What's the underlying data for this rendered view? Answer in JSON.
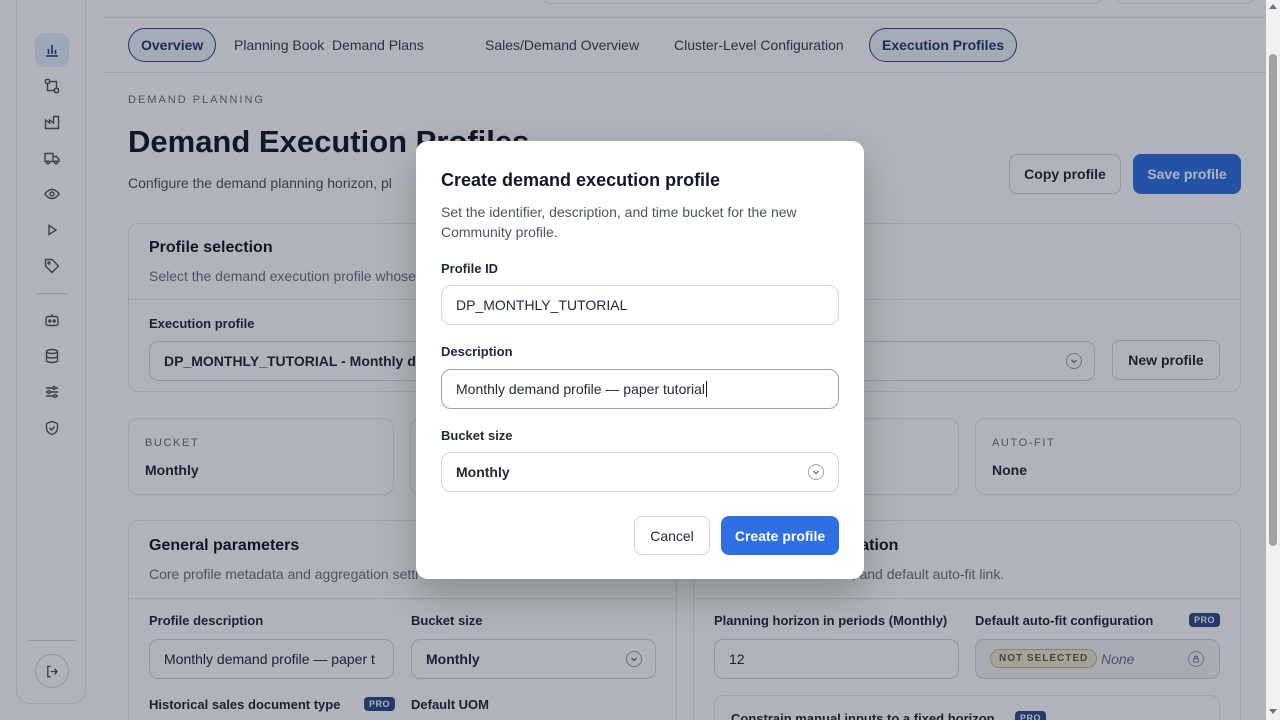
{
  "tabs": [
    {
      "label": "Overview"
    },
    {
      "label": "Planning Book"
    },
    {
      "label": "Demand Plans"
    },
    {
      "label": "Sales/Demand Overview"
    },
    {
      "label": "Cluster-Level Configuration"
    },
    {
      "label": "Execution Profiles"
    }
  ],
  "sidebar": {
    "icons": [
      "bar-chart-icon",
      "workflow-icon",
      "factory-icon",
      "truck-icon",
      "eye-icon",
      "play-icon",
      "tag-icon",
      "robot-icon",
      "database-icon",
      "sliders-icon",
      "shield-check-icon"
    ],
    "logout_icon": "logout-icon"
  },
  "header": {
    "eyebrow": "DEMAND PLANNING",
    "title": "Demand Execution Profiles",
    "subtitle": "Configure the demand planning horizon, pl",
    "copy_button": "Copy profile",
    "save_button": "Save profile"
  },
  "profile_selection": {
    "title": "Profile selection",
    "subtitle": "Select the demand execution profile whose",
    "field_label": "Execution profile",
    "selected_value": "DP_MONTHLY_TUTORIAL - Monthly der",
    "new_button": "New profile"
  },
  "stats": [
    {
      "key": "BUCKET",
      "value": "Monthly"
    },
    {
      "key": "AUTO-FIT",
      "value": "None"
    }
  ],
  "general": {
    "title": "General parameters",
    "subtitle": "Core profile metadata and aggregation setti",
    "profile_description_label": "Profile description",
    "profile_description_value": "Monthly demand profile — paper t",
    "bucket_size_label": "Bucket size",
    "bucket_size_value": "Monthly",
    "hist_doc_label": "Historical sales document type",
    "hist_doc_badge": "PRO",
    "uom_label": "Default UOM"
  },
  "horizon": {
    "title_fragment": "ration",
    "subtitle_fragment": "ndow, and default auto-fit link.",
    "periods_label": "Planning horizon in periods (Monthly)",
    "periods_value": "12",
    "autofit_label": "Default auto-fit configuration",
    "autofit_badge": "PRO",
    "autofit_chip": "NOT SELECTED",
    "autofit_value": "None",
    "constrain_label": "Constrain manual inputs to a fixed horizon",
    "constrain_badge": "PRO"
  },
  "modal": {
    "title": "Create demand execution profile",
    "description": "Set the identifier, description, and time bucket for the new Community profile.",
    "profile_id_label": "Profile ID",
    "profile_id_value": "DP_MONTHLY_TUTORIAL",
    "description_label": "Description",
    "description_value": "Monthly demand profile — paper tutorial",
    "bucket_label": "Bucket size",
    "bucket_value": "Monthly",
    "cancel_label": "Cancel",
    "create_label": "Create profile"
  }
}
